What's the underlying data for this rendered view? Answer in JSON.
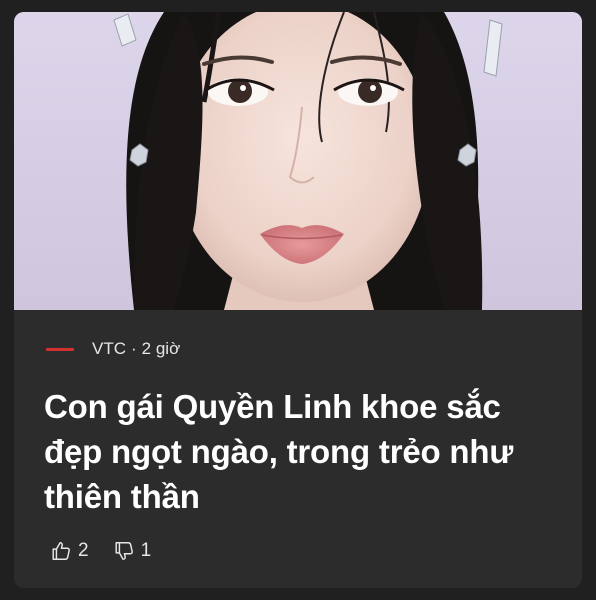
{
  "article": {
    "source": {
      "name": "VTC",
      "separator": "·",
      "time": "2 giờ",
      "brand_color": "#d32f2f"
    },
    "headline": "Con gái Quyền Linh khoe sắc đẹp ngọt ngào, trong trẻo như thiên thần",
    "image": {
      "subject": "portrait-photo",
      "background_color": "#d8d0e6"
    },
    "reactions": {
      "like": {
        "icon": "thumbs-up-icon",
        "count": "2"
      },
      "dislike": {
        "icon": "thumbs-down-icon",
        "count": "1"
      }
    }
  }
}
